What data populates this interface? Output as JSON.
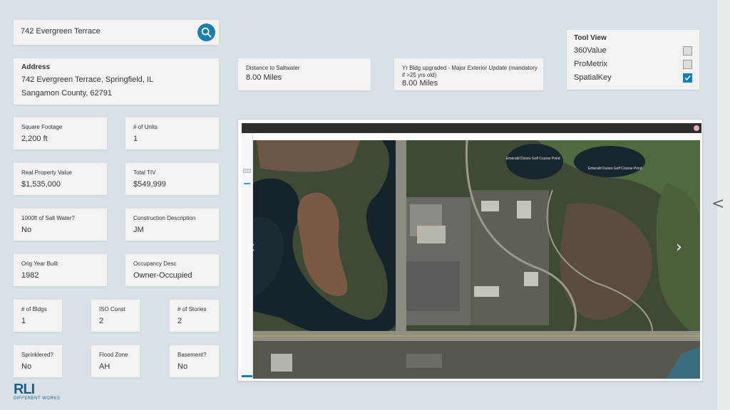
{
  "search": {
    "value": "742 Evergreen Terrace",
    "icon": "search-icon"
  },
  "address": {
    "heading": "Address",
    "line1": "742 Evergreen Terrace, Springfield, IL",
    "line2": "Sangamon County, 62791"
  },
  "distance": {
    "label": "Distance to Saltwater",
    "value": "8.00 Miles"
  },
  "yr_upgraded": {
    "label": "Yr Bldg upgraded - Major Exterior Update (mandatory if >25 yrs old)",
    "value": "8.00 Miles"
  },
  "tool_view": {
    "heading": "Tool View",
    "options": [
      {
        "label": "360Value",
        "checked": false
      },
      {
        "label": "ProMetrix",
        "checked": false
      },
      {
        "label": "SpatialKey",
        "checked": true
      }
    ]
  },
  "fields": {
    "sqft": {
      "label": "Square Footage",
      "value": "2,200 ft"
    },
    "units": {
      "label": "# of Units",
      "value": "1"
    },
    "rpv": {
      "label": "Real Property Value",
      "value": "$1,535,000"
    },
    "tiv": {
      "label": "Total TIV",
      "value": "$549,999"
    },
    "saltwater": {
      "label": "1000ft of Salt Water?",
      "value": "No"
    },
    "construction": {
      "label": "Construction Description",
      "value": "JM"
    },
    "year_built": {
      "label": "Orig Year Built",
      "value": "1982"
    },
    "occupancy": {
      "label": "Occupancy Desc",
      "value": "Owner-Occupied"
    },
    "bldgs": {
      "label": "# of Bldgs",
      "value": "1"
    },
    "iso": {
      "label": "ISO Const",
      "value": "2"
    },
    "stories": {
      "label": "# of Stories",
      "value": "2"
    },
    "sprinklered": {
      "label": "Sprinklered?",
      "value": "No"
    },
    "flood": {
      "label": "Flood Zone",
      "value": "AH"
    },
    "basement": {
      "label": "Basement?",
      "value": "No"
    }
  },
  "map": {
    "labels": [
      "Emerald Dunes Golf Course Pond",
      "Emerald Dunes Golf Course Pond"
    ],
    "prev_arrow": "‹",
    "next_arrow": "›"
  },
  "collapse_glyph": "<",
  "logo": {
    "mark": "RLI",
    "tagline": "DIFFERENT WORKS"
  },
  "colors": {
    "accent": "#1a7fae",
    "background": "#d8e1e6",
    "card": "#f3f3f3",
    "brand": "#1f5f8b"
  }
}
